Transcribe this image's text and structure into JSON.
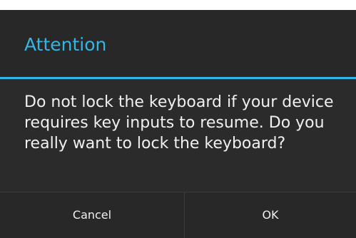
{
  "dialog": {
    "title": "Attention",
    "message": "Do not lock the keyboard if your device requires key inputs to resume. Do you really want to lock the keyboard?",
    "buttons": {
      "cancel_label": "Cancel",
      "ok_label": "OK"
    }
  },
  "colors": {
    "accent": "#33b5e5",
    "background": "#2b2b2b",
    "text": "#f0f0f0"
  }
}
